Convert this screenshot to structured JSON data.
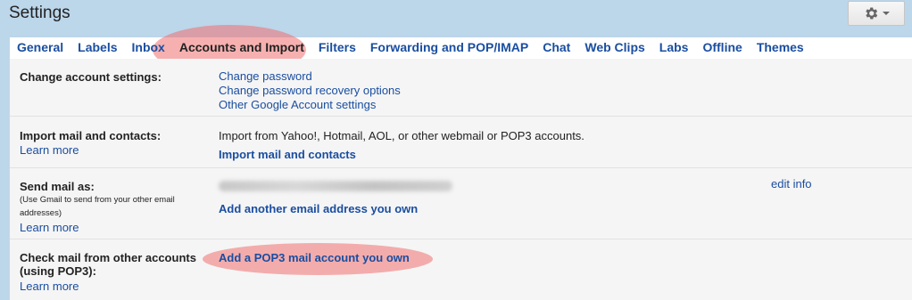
{
  "header": {
    "title": "Settings",
    "gear_icon": "gear-icon"
  },
  "tabs": [
    {
      "label": "General",
      "active": false
    },
    {
      "label": "Labels",
      "active": false
    },
    {
      "label": "Inbox",
      "active": false
    },
    {
      "label": "Accounts and Import",
      "active": true
    },
    {
      "label": "Filters",
      "active": false
    },
    {
      "label": "Forwarding and POP/IMAP",
      "active": false
    },
    {
      "label": "Chat",
      "active": false
    },
    {
      "label": "Web Clips",
      "active": false
    },
    {
      "label": "Labs",
      "active": false
    },
    {
      "label": "Offline",
      "active": false
    },
    {
      "label": "Themes",
      "active": false
    }
  ],
  "sections": {
    "change_account": {
      "label": "Change account settings:",
      "links": [
        "Change password",
        "Change password recovery options",
        "Other Google Account settings"
      ]
    },
    "import_mail": {
      "label": "Import mail and contacts:",
      "learn_more": "Learn more",
      "description": "Import from Yahoo!, Hotmail, AOL, or other webmail or POP3 accounts.",
      "action": "Import mail and contacts"
    },
    "send_mail": {
      "label": "Send mail as:",
      "sub": "(Use Gmail to send from your other email addresses)",
      "learn_more": "Learn more",
      "edit_info": "edit info",
      "action": "Add another email address you own"
    },
    "check_mail": {
      "label": "Check mail from other accounts (using POP3):",
      "learn_more": "Learn more",
      "action": "Add a POP3 mail account you own"
    }
  },
  "colors": {
    "link": "#1a4ea0",
    "header_bg": "#bcd6ea",
    "highlight": "#f07070"
  }
}
